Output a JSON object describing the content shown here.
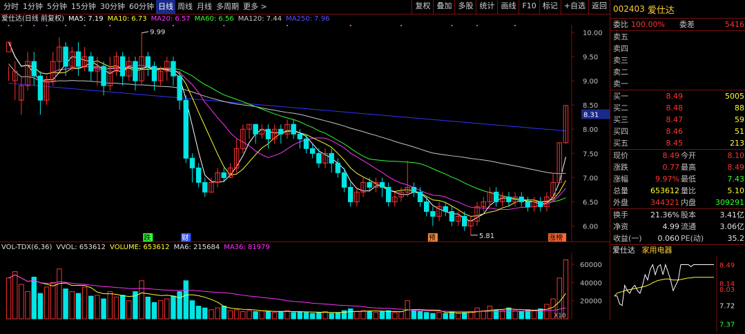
{
  "toolbar": {
    "periods": [
      "分时",
      "1分钟",
      "5分钟",
      "15分钟",
      "30分钟",
      "60分钟",
      "日线",
      "周线",
      "月线",
      "多周期",
      "更多 >"
    ],
    "active_period": "日线",
    "buttons": [
      "复权",
      "叠加",
      "多股",
      "统计",
      "画线",
      "F10",
      "标记",
      "+自选",
      "返回"
    ]
  },
  "legend": {
    "title": "爱仕达(日线 前复权)",
    "ma5": "MA5: 7.19",
    "ma10": "MA10: 6.73",
    "ma20": "MA20: 6.57",
    "ma60": "MA60: 6.56",
    "ma120": "MA120: 7.44",
    "ma250": "MA250: 7.96"
  },
  "colors": {
    "up": "#ff3333",
    "down": "#00e5e5",
    "ma5": "#ffffff",
    "ma10": "#ffff33",
    "ma20": "#ff33ff",
    "ma60": "#33ff33",
    "ma120": "#c8c8c8",
    "ma250": "#3333ff",
    "border": "#7a1010"
  },
  "chart_data": [
    {
      "type": "candlestick",
      "title": "爱仕达(日线 前复权)",
      "ylim": [
        5.85,
        10.1
      ],
      "yticks": [
        "10.00",
        "9.50",
        "9.00",
        "8.50",
        "8.00",
        "7.50",
        "7.00",
        "6.50",
        "6.00"
      ],
      "candles": [
        [
          9.6,
          9.8,
          9.3,
          9.0
        ],
        [
          9.0,
          9.2,
          9.4,
          8.6
        ],
        [
          8.6,
          8.9,
          9.1,
          8.3
        ],
        [
          8.9,
          9.4,
          9.6,
          8.8
        ],
        [
          9.4,
          9.1,
          9.6,
          8.9
        ],
        [
          9.1,
          8.6,
          9.2,
          8.3
        ],
        [
          8.6,
          9.0,
          9.1,
          8.5
        ],
        [
          9.0,
          9.4,
          9.6,
          8.9
        ],
        [
          9.4,
          9.7,
          9.9,
          9.2
        ],
        [
          9.7,
          9.3,
          9.8,
          9.1
        ],
        [
          9.3,
          9.6,
          9.7,
          9.2
        ],
        [
          9.6,
          9.3,
          9.8,
          9.1
        ],
        [
          9.3,
          9.5,
          9.7,
          9.2
        ],
        [
          9.5,
          9.2,
          9.6,
          9.0
        ],
        [
          9.2,
          9.3,
          9.5,
          8.9
        ],
        [
          9.3,
          8.9,
          9.4,
          8.7
        ],
        [
          8.9,
          9.2,
          9.5,
          8.8
        ],
        [
          9.2,
          9.5,
          9.6,
          9.1
        ],
        [
          9.5,
          9.1,
          9.6,
          8.9
        ],
        [
          9.1,
          9.4,
          9.5,
          9.0
        ],
        [
          9.4,
          9.0,
          9.5,
          8.8
        ],
        [
          9.0,
          9.5,
          9.99,
          8.9
        ],
        [
          9.5,
          9.3,
          9.6,
          9.1
        ],
        [
          9.3,
          9.0,
          9.4,
          8.8
        ],
        [
          9.0,
          9.2,
          9.3,
          8.9
        ],
        [
          9.2,
          9.4,
          9.5,
          9.0
        ],
        [
          9.4,
          9.1,
          9.5,
          8.9
        ],
        [
          9.1,
          8.6,
          9.2,
          8.4
        ],
        [
          8.6,
          7.4,
          8.7,
          7.3
        ],
        [
          7.4,
          7.2,
          7.5,
          6.9
        ],
        [
          7.2,
          6.9,
          7.3,
          6.8
        ],
        [
          6.9,
          6.7,
          7.0,
          6.6
        ],
        [
          6.7,
          6.9,
          7.0,
          6.7
        ],
        [
          6.9,
          7.1,
          7.2,
          6.8
        ],
        [
          7.1,
          7.0,
          7.2,
          6.9
        ],
        [
          7.0,
          7.2,
          7.3,
          7.0
        ],
        [
          7.2,
          7.6,
          7.8,
          7.1
        ],
        [
          7.6,
          8.0,
          8.1,
          7.5
        ],
        [
          8.0,
          8.1,
          8.1,
          7.8
        ],
        [
          8.1,
          7.9,
          8.1,
          7.7
        ],
        [
          7.9,
          8.0,
          8.1,
          7.8
        ],
        [
          8.0,
          7.8,
          8.1,
          7.6
        ],
        [
          7.8,
          8.0,
          8.1,
          7.7
        ],
        [
          8.0,
          7.9,
          8.1,
          7.7
        ],
        [
          7.9,
          8.1,
          8.2,
          7.8
        ],
        [
          8.1,
          7.9,
          8.2,
          7.8
        ],
        [
          7.9,
          7.8,
          8.0,
          7.6
        ],
        [
          7.8,
          7.6,
          7.9,
          7.5
        ],
        [
          7.6,
          7.5,
          7.7,
          7.4
        ],
        [
          7.5,
          7.3,
          7.6,
          7.2
        ],
        [
          7.3,
          7.5,
          7.6,
          7.2
        ],
        [
          7.5,
          7.3,
          7.6,
          7.1
        ],
        [
          7.3,
          7.1,
          7.4,
          7.0
        ],
        [
          7.1,
          6.8,
          7.2,
          6.7
        ],
        [
          6.8,
          6.5,
          6.9,
          6.4
        ],
        [
          6.5,
          6.7,
          6.8,
          6.4
        ],
        [
          6.7,
          6.9,
          7.0,
          6.6
        ],
        [
          6.9,
          6.8,
          7.0,
          6.7
        ],
        [
          6.8,
          6.9,
          7.0,
          6.7
        ],
        [
          6.9,
          6.8,
          7.0,
          6.6
        ],
        [
          6.8,
          6.5,
          6.9,
          6.4
        ],
        [
          6.5,
          6.6,
          6.7,
          6.4
        ],
        [
          6.6,
          6.7,
          6.8,
          6.5
        ],
        [
          6.7,
          6.8,
          7.35,
          6.6
        ],
        [
          6.8,
          6.7,
          6.9,
          6.6
        ],
        [
          6.7,
          6.5,
          6.8,
          6.4
        ],
        [
          6.5,
          6.3,
          6.6,
          6.2
        ],
        [
          6.3,
          6.2,
          6.4,
          6.0
        ],
        [
          6.2,
          6.4,
          6.5,
          6.1
        ],
        [
          6.4,
          6.3,
          6.5,
          6.2
        ],
        [
          6.3,
          6.1,
          6.4,
          6.0
        ],
        [
          6.1,
          6.2,
          6.3,
          6.0
        ],
        [
          6.2,
          6.0,
          6.3,
          5.9
        ],
        [
          6.0,
          6.1,
          6.2,
          5.81
        ],
        [
          6.1,
          6.4,
          6.5,
          6.0
        ],
        [
          6.4,
          6.5,
          6.6,
          6.3
        ],
        [
          6.5,
          6.7,
          6.8,
          6.4
        ],
        [
          6.7,
          6.5,
          6.8,
          6.4
        ],
        [
          6.5,
          6.6,
          6.7,
          6.4
        ],
        [
          6.6,
          6.5,
          6.7,
          6.4
        ],
        [
          6.5,
          6.6,
          6.7,
          6.4
        ],
        [
          6.6,
          6.5,
          6.7,
          6.4
        ],
        [
          6.5,
          6.4,
          6.6,
          6.3
        ],
        [
          6.4,
          6.5,
          6.6,
          6.3
        ],
        [
          6.5,
          6.4,
          6.6,
          6.3
        ],
        [
          6.4,
          6.6,
          6.7,
          6.3
        ],
        [
          6.6,
          6.9,
          7.1,
          6.5
        ],
        [
          6.9,
          7.72,
          7.72,
          6.9
        ],
        [
          7.72,
          8.49,
          8.49,
          7.7
        ]
      ],
      "annotations": {
        "max_label": "9.99",
        "min_label": "5.81",
        "price_tag": "8.31"
      },
      "events": [
        "跌",
        "财",
        "预",
        "涨榜"
      ]
    },
    {
      "type": "bar",
      "title": "VOL-TDX(6,36)",
      "ylim": [
        0,
        70000
      ],
      "yticks": [
        "60000",
        "40000",
        "20000"
      ],
      "unit_label": "X10",
      "values": [
        45000,
        52000,
        38000,
        30000,
        46000,
        28000,
        35000,
        40000,
        55000,
        33000,
        30000,
        28000,
        35000,
        25000,
        26000,
        22000,
        30000,
        24000,
        26000,
        20000,
        30000,
        42000,
        24000,
        18000,
        20000,
        22000,
        25000,
        30000,
        42000,
        20000,
        14000,
        12000,
        10000,
        12000,
        14000,
        9000,
        10000,
        8000,
        9000,
        8000,
        9000,
        8000,
        7000,
        8000,
        9000,
        7000,
        8000,
        7000,
        6000,
        7000,
        8000,
        6000,
        7000,
        9000,
        11000,
        8000,
        9000,
        8000,
        7000,
        8000,
        9000,
        7000,
        8000,
        20000,
        9000,
        8000,
        7000,
        6000,
        7000,
        6000,
        8000,
        6000,
        7000,
        8000,
        12000,
        9000,
        14000,
        10000,
        9000,
        12000,
        9000,
        8000,
        10000,
        9000,
        11000,
        16000,
        22000,
        45000,
        65000
      ],
      "legend": {
        "name": "VOL-TDX(6,36)",
        "vvol": "VVOL: 653612",
        "volume": "VOLUME: 653612",
        "ma6": "MA6: 215684",
        "ma36": "MA36: 81979"
      }
    },
    {
      "type": "line",
      "title": "爱仕达 家用电器",
      "yticks": [
        "8.49",
        "8.14",
        "8.03",
        "7.72",
        "7.37"
      ],
      "prices": [
        7.9,
        7.9,
        7.75,
        7.72,
        8.1,
        8.0,
        7.95,
        8.05,
        8.1,
        8.0,
        7.95,
        8.1,
        8.3,
        8.2,
        8.4,
        8.49,
        8.3,
        8.45,
        8.49,
        8.3,
        8.49,
        8.35,
        8.2,
        8.0,
        8.1,
        8.2,
        8.49,
        8.49,
        8.49,
        8.49,
        8.45,
        8.49,
        8.49,
        8.49,
        8.49,
        8.49,
        8.49,
        8.49,
        8.49,
        8.49
      ],
      "avg": [
        7.9,
        7.95,
        7.97,
        7.98,
        8.0,
        8.01,
        8.02,
        8.03,
        8.04,
        8.05,
        8.06,
        8.07,
        8.08,
        8.1,
        8.12,
        8.15,
        8.17,
        8.19,
        8.2,
        8.21,
        8.22,
        8.22,
        8.21,
        8.2,
        8.2,
        8.2,
        8.21,
        8.22,
        8.23,
        8.24,
        8.24,
        8.25,
        8.25,
        8.25,
        8.25,
        8.25,
        8.25,
        8.25,
        8.25,
        8.25
      ]
    }
  ],
  "panel": {
    "code": "002403",
    "name": "爱仕达",
    "weibi_label": "委比",
    "weibi_value": "100.00%",
    "weicha_label": "委差",
    "weicha_value": "5416",
    "sells": [
      {
        "label": "卖五",
        "price": "",
        "vol": ""
      },
      {
        "label": "卖四",
        "price": "",
        "vol": ""
      },
      {
        "label": "卖三",
        "price": "",
        "vol": ""
      },
      {
        "label": "卖二",
        "price": "",
        "vol": ""
      },
      {
        "label": "卖一",
        "price": "",
        "vol": ""
      }
    ],
    "buys": [
      {
        "label": "买一",
        "price": "8.49",
        "vol": "5005"
      },
      {
        "label": "买二",
        "price": "8.48",
        "vol": "88"
      },
      {
        "label": "买三",
        "price": "8.47",
        "vol": "59"
      },
      {
        "label": "买四",
        "price": "8.46",
        "vol": "51"
      },
      {
        "label": "买五",
        "price": "8.45",
        "vol": "213"
      }
    ],
    "stats": [
      {
        "l1": "现价",
        "v1": "8.49",
        "c1": "red",
        "l2": "今开",
        "v2": "8.10",
        "c2": "red"
      },
      {
        "l1": "涨跌",
        "v1": "0.77",
        "c1": "red",
        "l2": "最高",
        "v2": "8.49",
        "c2": "red"
      },
      {
        "l1": "涨幅",
        "v1": "9.97%",
        "c1": "red",
        "l2": "最低",
        "v2": "7.43",
        "c2": "green"
      },
      {
        "l1": "总量",
        "v1": "653612",
        "c1": "yellow",
        "l2": "量比",
        "v2": "5.10",
        "c2": "yellow"
      },
      {
        "l1": "外盘",
        "v1": "344321",
        "c1": "red",
        "l2": "内盘",
        "v2": "309291",
        "c2": "green"
      }
    ],
    "stats2": [
      {
        "l1": "换手",
        "v1": "21.36%",
        "c1": "white",
        "l2": "股本",
        "v2": "3.41亿",
        "c2": "white"
      },
      {
        "l1": "净资",
        "v1": "4.99",
        "c1": "white",
        "l2": "流通",
        "v2": "3.06亿",
        "c2": "white"
      },
      {
        "l1": "收益(一)",
        "v1": "0.060",
        "c1": "white",
        "l2": "PE(动)",
        "v2": "35.2",
        "c2": "white"
      }
    ],
    "mini_name": "爱仕达",
    "mini_industry": "家用电器"
  }
}
